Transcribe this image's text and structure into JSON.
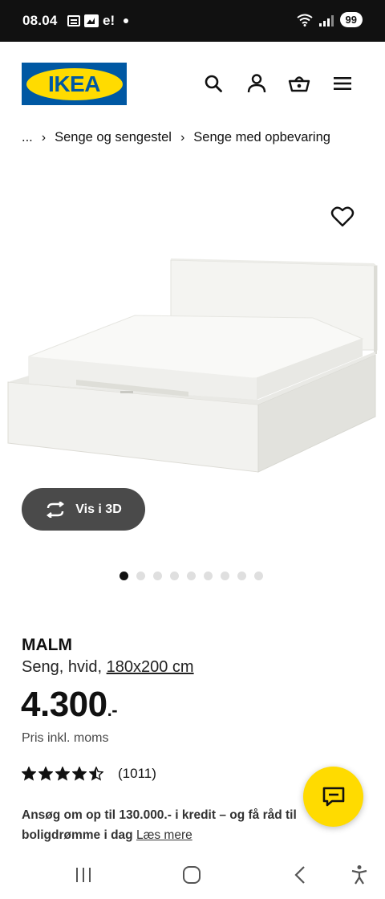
{
  "status_bar": {
    "time": "08.04",
    "left_text": "e!",
    "battery": "99",
    "icons": [
      "news-icon",
      "gallery-icon",
      "notification-dot-icon",
      "wifi-icon",
      "signal-icon",
      "battery-icon"
    ]
  },
  "header": {
    "logo_text": "IKEA",
    "icons": [
      "search-icon",
      "account-icon",
      "basket-icon",
      "menu-icon"
    ],
    "colors": {
      "logo_blue": "#0058a3",
      "logo_yellow": "#ffdb00"
    }
  },
  "breadcrumb": {
    "items": [
      "...",
      "Senge og sengestel",
      "Senge med opbevaring"
    ]
  },
  "gallery": {
    "view_3d_label": "Vis i 3D",
    "image_count": 9,
    "active_index": 0
  },
  "product": {
    "name": "MALM",
    "description": "Seng, hvid, ",
    "size": "180x200 cm",
    "price": "4.300",
    "price_suffix": ".-",
    "vat_note": "Pris inkl. moms",
    "rating": 4.5,
    "review_count": "(1011)"
  },
  "promo": {
    "text": "Ansøg om op til 130.000.- i kredit – og få råd til boligdrømme i dag ",
    "link": "Læs mere"
  },
  "chat": {
    "icon": "chat-icon",
    "color": "#ffdb00"
  },
  "navbar": {
    "icons": [
      "recent-apps-icon",
      "home-icon",
      "back-icon",
      "accessibility-icon"
    ]
  }
}
